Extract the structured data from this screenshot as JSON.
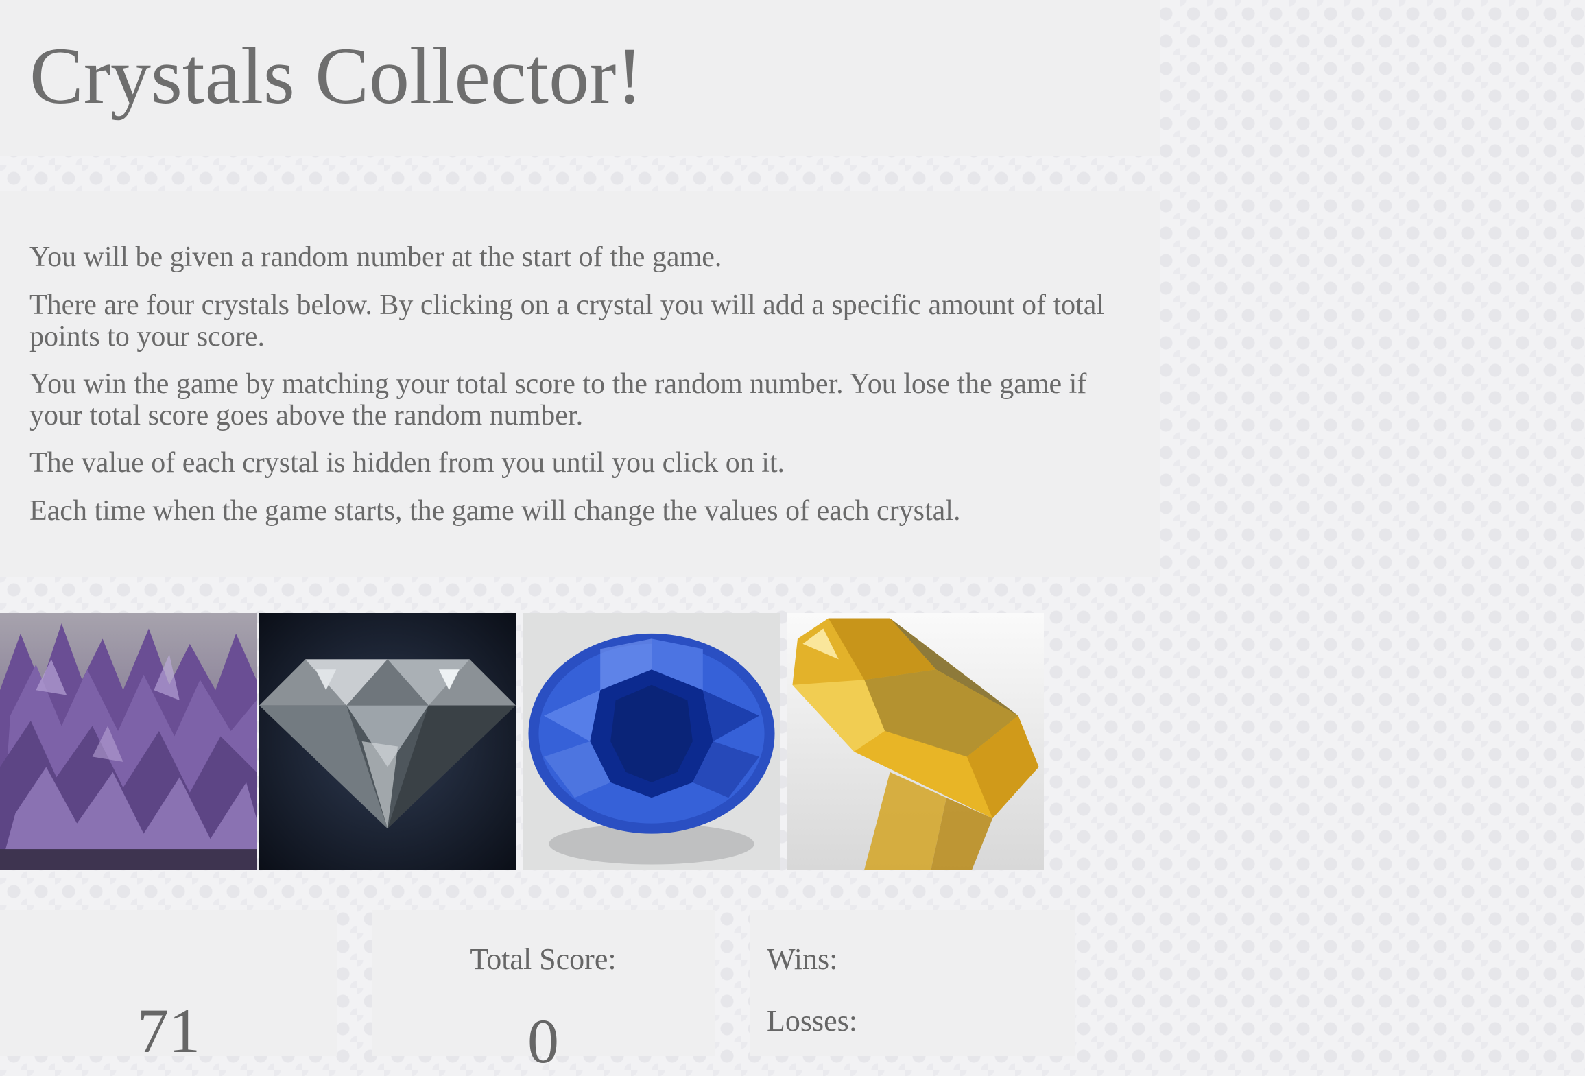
{
  "header": {
    "title": "Crystals Collector!"
  },
  "instructions": [
    "You will be given a random number at the start of the game.",
    "There are four crystals below. By clicking on a crystal you will add a specific amount of total points to your score.",
    "You win the game by matching your total score to the random number. You lose the game if your total score goes above the random number.",
    "The value of each crystal is hidden from you until you click on it.",
    "Each time when the game starts, the game will change the values of each crystal."
  ],
  "crystals": [
    {
      "name": "amethyst",
      "color": "#6b4f95"
    },
    {
      "name": "diamond",
      "color": "#1d2535"
    },
    {
      "name": "sapphire",
      "color": "#1f3fa6"
    },
    {
      "name": "citrine",
      "color": "#e2b21e"
    }
  ],
  "scoreboard": {
    "random_number": "71",
    "total_label": "Total Score:",
    "total_value": "0",
    "wins_label": "Wins:",
    "losses_label": "Losses:"
  }
}
